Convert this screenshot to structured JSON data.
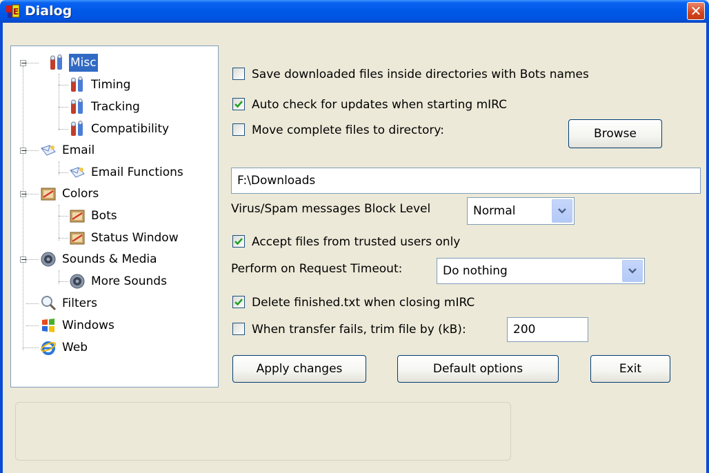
{
  "window": {
    "title": "Dialog",
    "close_icon": "close-icon",
    "app_icon": "mirc-icon"
  },
  "tree": {
    "items": [
      {
        "label": "Misc",
        "icon": "tools-icon",
        "expanded": true,
        "selected": true
      },
      {
        "label": "Timing",
        "icon": "tools-icon"
      },
      {
        "label": "Tracking",
        "icon": "tools-icon"
      },
      {
        "label": "Compatibility",
        "icon": "tools-icon"
      },
      {
        "label": "Email",
        "icon": "email-icon",
        "expanded": true
      },
      {
        "label": "Email Functions",
        "icon": "email-icon"
      },
      {
        "label": "Colors",
        "icon": "colors-icon",
        "expanded": true
      },
      {
        "label": "Bots",
        "icon": "colors-icon"
      },
      {
        "label": "Status Window",
        "icon": "colors-icon"
      },
      {
        "label": "Sounds & Media",
        "icon": "speaker-icon",
        "expanded": true
      },
      {
        "label": "More Sounds",
        "icon": "speaker-icon"
      },
      {
        "label": "Filters",
        "icon": "magnifier-icon"
      },
      {
        "label": "Windows",
        "icon": "windows-icon"
      },
      {
        "label": "Web",
        "icon": "ie-icon"
      }
    ]
  },
  "options": {
    "save_bots_dirs": {
      "label": "Save downloaded files inside directories with Bots names",
      "checked": false
    },
    "auto_check_updates": {
      "label": "Auto check for updates when starting mIRC",
      "checked": true
    },
    "move_complete": {
      "label": "Move complete files to directory:",
      "checked": false
    },
    "browse_label": "Browse",
    "directory_value": "F:\\Downloads",
    "block_level_label": "Virus/Spam messages Block Level",
    "block_level_value": "Normal",
    "accept_trusted": {
      "label": "Accept files from trusted users only",
      "checked": true
    },
    "timeout_label": "Perform on Request Timeout:",
    "timeout_value": "Do nothing",
    "delete_finished": {
      "label": "Delete finished.txt when closing mIRC",
      "checked": true
    },
    "trim_on_fail": {
      "label": "When transfer fails, trim file by (kB):",
      "checked": false
    },
    "trim_value": "200"
  },
  "buttons": {
    "apply": "Apply changes",
    "defaults": "Default options",
    "exit": "Exit"
  },
  "colors": {
    "titlebar": "#0054e3",
    "selection": "#316ac5",
    "dialog_bg": "#ece9d8",
    "check": "#21a121"
  }
}
